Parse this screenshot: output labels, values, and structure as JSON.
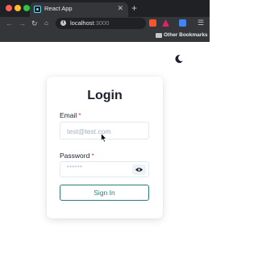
{
  "browser": {
    "tab_title": "React App",
    "tab_close": "✕",
    "new_tab": "+",
    "url_host": "localhost",
    "url_port": ":3000",
    "info_glyph": "i",
    "bookmark_label": "Other Bookmarks",
    "nav": {
      "back": "←",
      "forward": "→",
      "reload": "↻",
      "home": "⌂",
      "menu": "☰"
    }
  },
  "page": {
    "theme_icon": "moon-icon"
  },
  "login": {
    "title": "Login",
    "email_label": "Email",
    "email_required": "*",
    "email_placeholder": "test@test.com",
    "password_label": "Password",
    "password_required": "*",
    "password_mask": "******",
    "show_password_icon": "eye-icon",
    "submit_label": "Sign In"
  },
  "colors": {
    "accent": "#2c7a7b",
    "required": "#e53e3e",
    "chrome_dark": "#202124"
  }
}
